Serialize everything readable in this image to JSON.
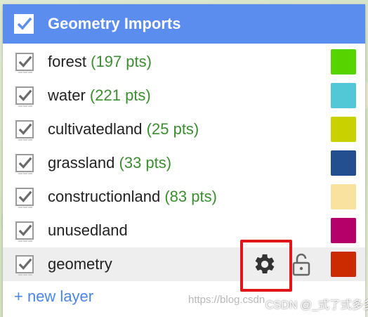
{
  "header": {
    "title": "Geometry Imports"
  },
  "layers": [
    {
      "name": "forest",
      "count": "(197 pts)",
      "color": "#55d400"
    },
    {
      "name": "water",
      "count": "(221 pts)",
      "color": "#52c8d6"
    },
    {
      "name": "cultivatedland",
      "count": "(25 pts)",
      "color": "#c9d200"
    },
    {
      "name": "grassland",
      "count": "(33 pts)",
      "color": "#234e8f"
    },
    {
      "name": "constructionland",
      "count": "(83 pts)",
      "color": "#f9e29f"
    },
    {
      "name": "unusedland",
      "count": "",
      "color": "#b5006a"
    },
    {
      "name": "geometry",
      "count": "",
      "color": "#cc2a00"
    }
  ],
  "new_layer_label": "+ new layer",
  "watermark": {
    "url": "https://blog.csdn",
    "text": "CSDN @_式了式多多"
  }
}
